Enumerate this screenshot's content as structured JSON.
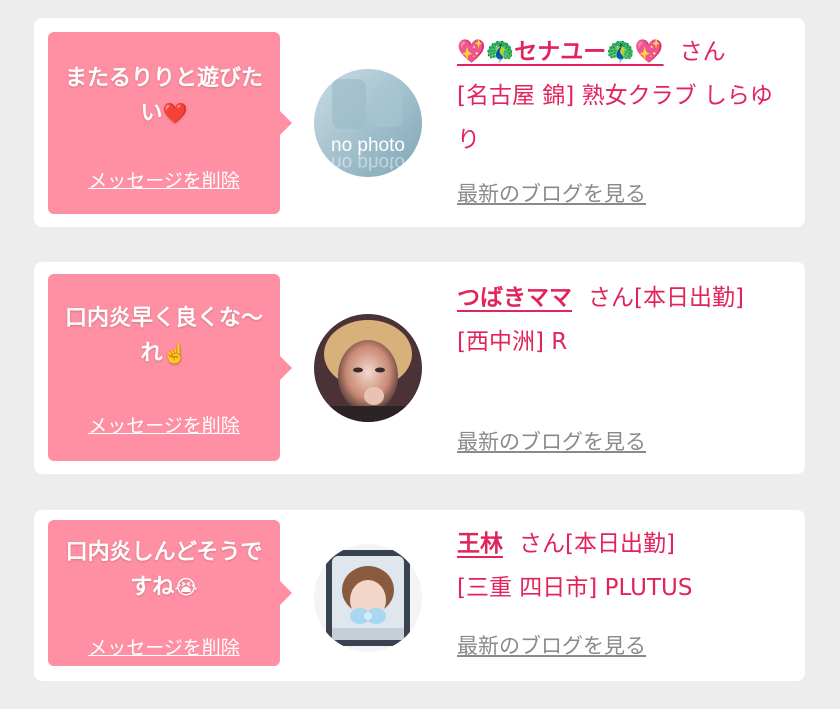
{
  "entries": [
    {
      "message": "またるりりと遊びたい",
      "message_emoji": "❤️",
      "delete_label": "メッセージを削除",
      "avatar_text": "no photo",
      "name": "💖🦚セナユー🦚💖",
      "suffix": "さん",
      "status": "",
      "location": "[名古屋 錦] 熟女クラブ しらゆり",
      "blog_label": "最新のブログを見る"
    },
    {
      "message": "口内炎早く良くな〜れ",
      "message_emoji": "☝️",
      "delete_label": "メッセージを削除",
      "name": "つばきママ",
      "suffix": "さん",
      "status": "[本日出勤]",
      "location": "[西中洲] R",
      "blog_label": "最新のブログを見る"
    },
    {
      "message": "口内炎しんどそうですね",
      "message_emoji": "😭",
      "delete_label": "メッセージを削除",
      "name": "王林",
      "suffix": "さん",
      "status": "[本日出勤]",
      "location": "[三重 四日市] PLUTUS",
      "blog_label": "最新のブログを見る"
    }
  ],
  "colors": {
    "accent": "#e2245c",
    "bubble": "#ff8fa3",
    "muted": "#8a8a8a",
    "background": "#ededed"
  }
}
